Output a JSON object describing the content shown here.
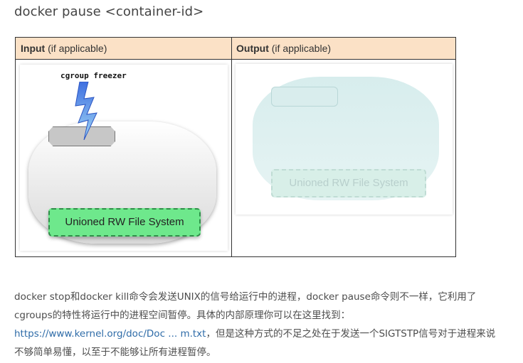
{
  "heading": "docker pause <container-id>",
  "table": {
    "input_header_bold": "Input",
    "input_header_rest": " (if applicable)",
    "output_header_bold": "Output",
    "output_header_rest": " (if applicable)"
  },
  "diagram": {
    "freezer_label": "cgroup freezer",
    "rw_fs_label": "Unioned RW File System",
    "rw_fs_label_output": "Unioned RW File System",
    "icons": [
      "lightning-bolt-icon"
    ],
    "colors": {
      "header_bg": "#fbe1c6",
      "rwfs_green": "#6ee88c",
      "output_tint": "#d5ecec",
      "link": "#2f6ca8"
    }
  },
  "paragraph": {
    "line1": "docker stop和docker kill命令会发送UNIX的信号给运行中的进程，docker pause命令则不一样，它利用了",
    "line2": "cgroups的特性将运行中的进程空间暂停。具体的内部原理你可以在这里找到：",
    "link_text": "https://www.kernel.org/doc/Doc ... m.txt",
    "line3_rest": "，但是这种方式的不足之处在于发送一个SIGTSTP信号对于进程来说",
    "line4": "不够简单易懂，以至于不能够让所有进程暂停。"
  }
}
